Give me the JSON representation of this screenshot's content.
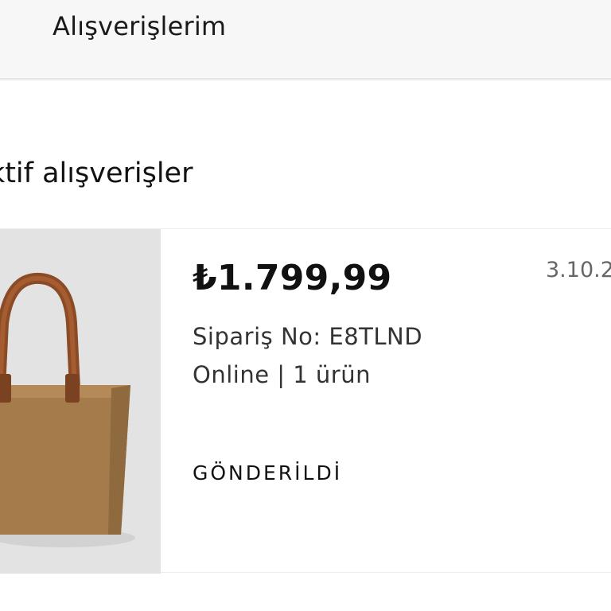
{
  "header": {
    "title": "Alışverişlerim"
  },
  "section": {
    "title": "Aktif alışverişler"
  },
  "order": {
    "price": "₺1.799,99",
    "date": "3.10.2",
    "order_no": "Sipariş No: E8TLND",
    "meta": "Online | 1 ürün",
    "status": "GÖNDERİLDİ",
    "product_image": "suede-tote-bag"
  }
}
